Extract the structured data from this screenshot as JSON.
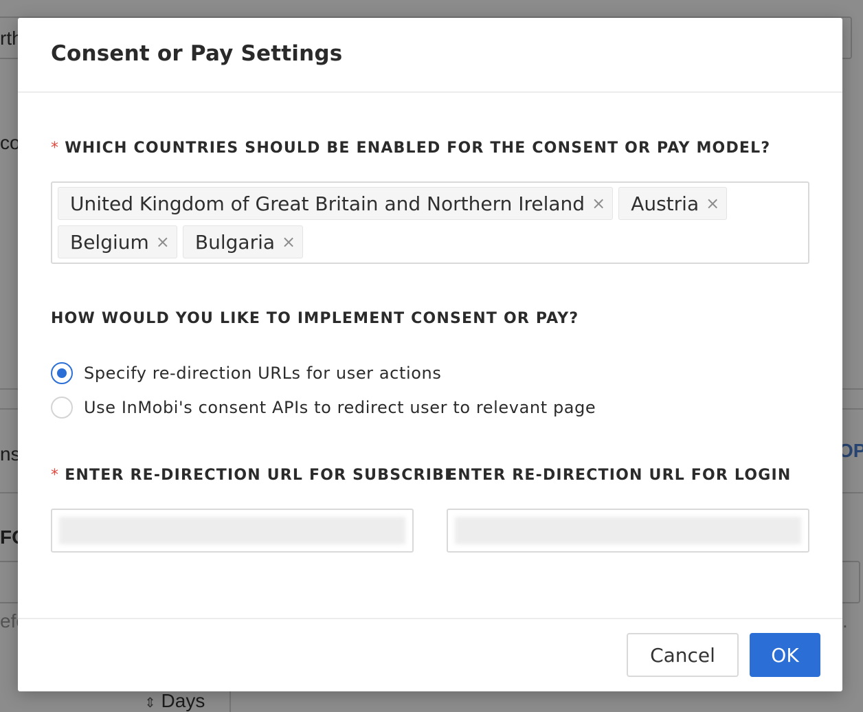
{
  "background": {
    "fragments": [
      "rth",
      "co",
      "nse",
      "FO",
      "efo",
      "Days",
      "OP",
      "."
    ]
  },
  "modal": {
    "title": "Consent or Pay Settings",
    "countries": {
      "required_mark": "*",
      "label": "WHICH COUNTRIES SHOULD BE ENABLED FOR THE CONSENT OR PAY MODEL?",
      "tags": [
        "United Kingdom of Great Britain and Northern Ireland",
        "Austria",
        "Belgium",
        "Bulgaria"
      ],
      "remove_glyph": "×"
    },
    "implementation": {
      "label": "HOW WOULD YOU LIKE TO IMPLEMENT CONSENT OR PAY?",
      "options": [
        {
          "label": "Specify re-direction URLs for user actions",
          "selected": true
        },
        {
          "label": "Use InMobi's consent APIs to redirect user to relevant page",
          "selected": false
        }
      ]
    },
    "subscribe_url": {
      "required_mark": "*",
      "label": "ENTER RE-DIRECTION URL FOR SUBSCRIBE"
    },
    "login_url": {
      "label": "ENTER RE-DIRECTION URL FOR LOGIN"
    },
    "footer": {
      "cancel_label": "Cancel",
      "ok_label": "OK"
    }
  },
  "colors": {
    "primary": "#2b6fd6",
    "required": "#e0483e"
  }
}
